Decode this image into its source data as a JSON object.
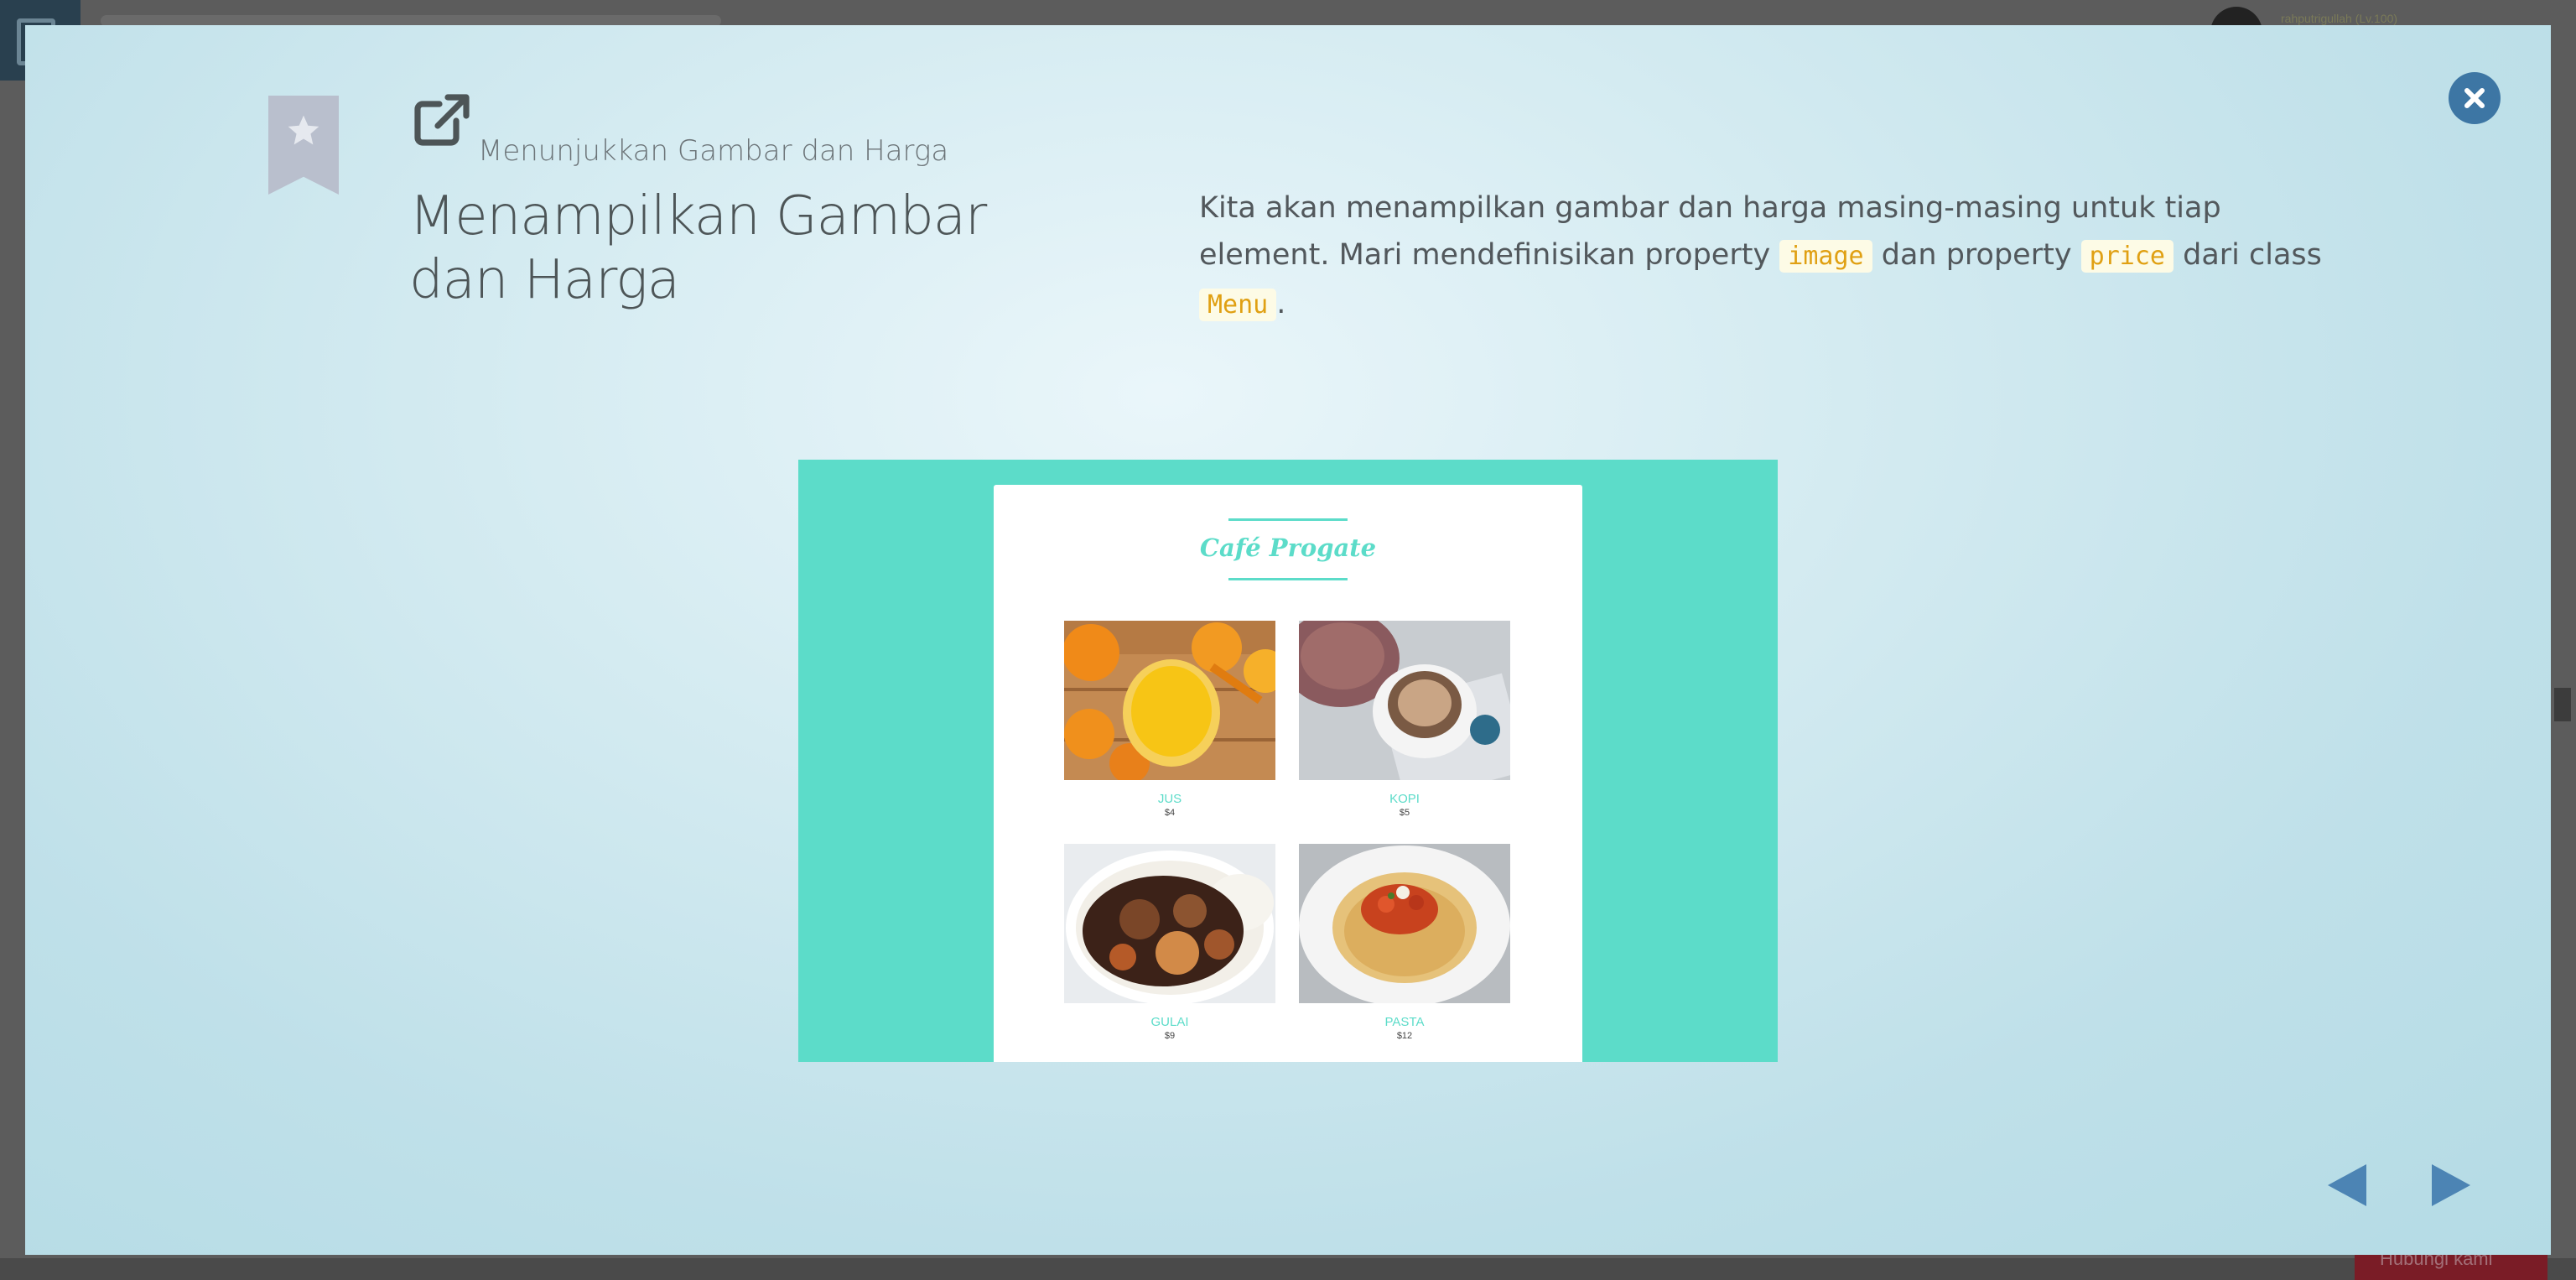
{
  "background": {
    "username": "rahputrigullah (Lv.100)",
    "help_label": "Hubungi kami"
  },
  "modal": {
    "breadcrumb": "Menunjukkan Gambar dan Harga",
    "title": "Menampilkan Gambar dan Harga",
    "description": {
      "part1": "Kita akan menampilkan gambar dan harga masing-masing untuk tiap element. Mari mendefinisikan property ",
      "code1": "image",
      "part2": " dan property ",
      "code2": "price",
      "part3": " dari class ",
      "code3": "Menu",
      "part4": "."
    },
    "icons": {
      "bookmark": "bookmark-star-icon",
      "external_link": "external-link-icon",
      "close": "close-icon",
      "prev": "arrow-left-icon",
      "next": "arrow-right-icon"
    },
    "colors": {
      "accent_teal": "#5cdcc9",
      "close_button": "#3d76a4",
      "code_text": "#e0a013"
    }
  },
  "preview": {
    "cafe_title": "Café Progate",
    "items": [
      {
        "name": "JUS",
        "price": "$4"
      },
      {
        "name": "KOPI",
        "price": "$5"
      },
      {
        "name": "GULAI",
        "price": "$9"
      },
      {
        "name": "PASTA",
        "price": "$12"
      }
    ]
  }
}
